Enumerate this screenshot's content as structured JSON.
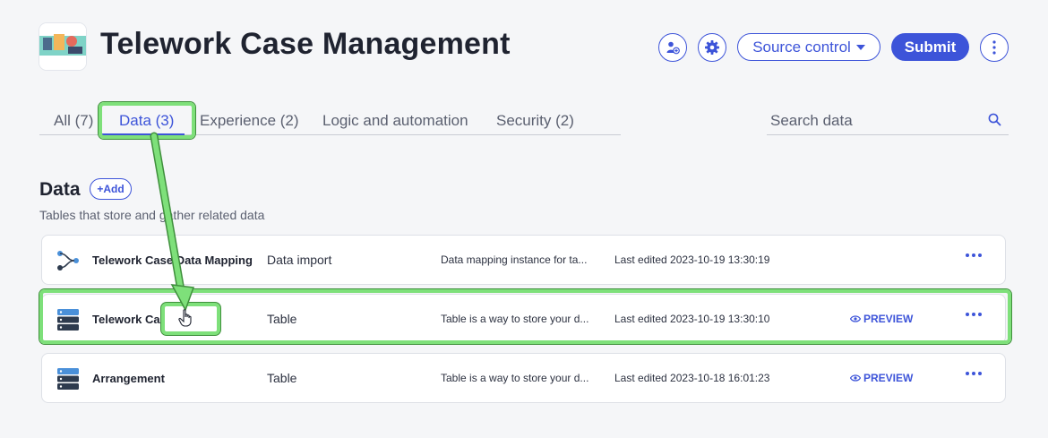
{
  "header": {
    "title": "Telework Case Management",
    "source_control_label": "Source control",
    "submit_label": "Submit"
  },
  "tabs": [
    {
      "label": "All (7)",
      "active": false
    },
    {
      "label": "Data (3)",
      "active": true
    },
    {
      "label": "Experience (2)",
      "active": false
    },
    {
      "label": "Logic and automation",
      "active": false
    },
    {
      "label": "Security (2)",
      "active": false
    }
  ],
  "search": {
    "placeholder": "Search data"
  },
  "section": {
    "title": "Data",
    "add_label": "+Add",
    "subtitle": "Tables that store and gather related data"
  },
  "rows": [
    {
      "name": "Telework Case Data Mapping",
      "type": "Data import",
      "description": "Data mapping instance for ta...",
      "edited": "Last edited 2023-10-19 13:30:19",
      "preview": "",
      "icon": "data-mapping-icon"
    },
    {
      "name": "Telework Case",
      "type": "Table",
      "description": "Table is a way to store your d...",
      "edited": "Last edited 2023-10-19 13:30:10",
      "preview": "PREVIEW",
      "icon": "table-icon"
    },
    {
      "name": "Arrangement",
      "type": "Table",
      "description": "Table is a way to store your d...",
      "edited": "Last edited 2023-10-18 16:01:23",
      "preview": "PREVIEW",
      "icon": "table-icon"
    }
  ],
  "colors": {
    "accent": "#3d54d9",
    "highlight": "#7ee07a",
    "text": "#1f2330"
  }
}
